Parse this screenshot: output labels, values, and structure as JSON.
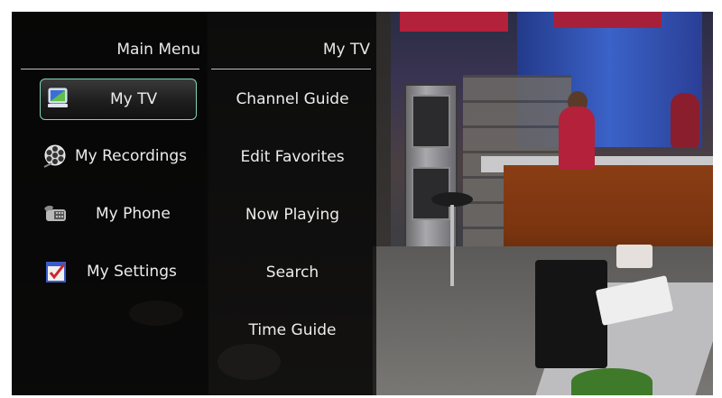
{
  "main_menu": {
    "title": "Main Menu",
    "items": [
      {
        "label": "My TV",
        "icon": "tv-monitor-icon",
        "selected": true
      },
      {
        "label": "My Recordings",
        "icon": "film-reel-icon",
        "selected": false
      },
      {
        "label": "My Phone",
        "icon": "phone-icon",
        "selected": false
      },
      {
        "label": "My Settings",
        "icon": "settings-checklist-icon",
        "selected": false
      }
    ]
  },
  "sub_menu": {
    "title": "My TV",
    "items": [
      {
        "label": "Channel Guide"
      },
      {
        "label": "Edit Favorites"
      },
      {
        "label": "Now Playing"
      },
      {
        "label": "Search"
      },
      {
        "label": "Time Guide"
      }
    ]
  },
  "colors": {
    "selection_border": "#7fd3b8",
    "text": "#ececec",
    "panel_background": "#000000"
  }
}
